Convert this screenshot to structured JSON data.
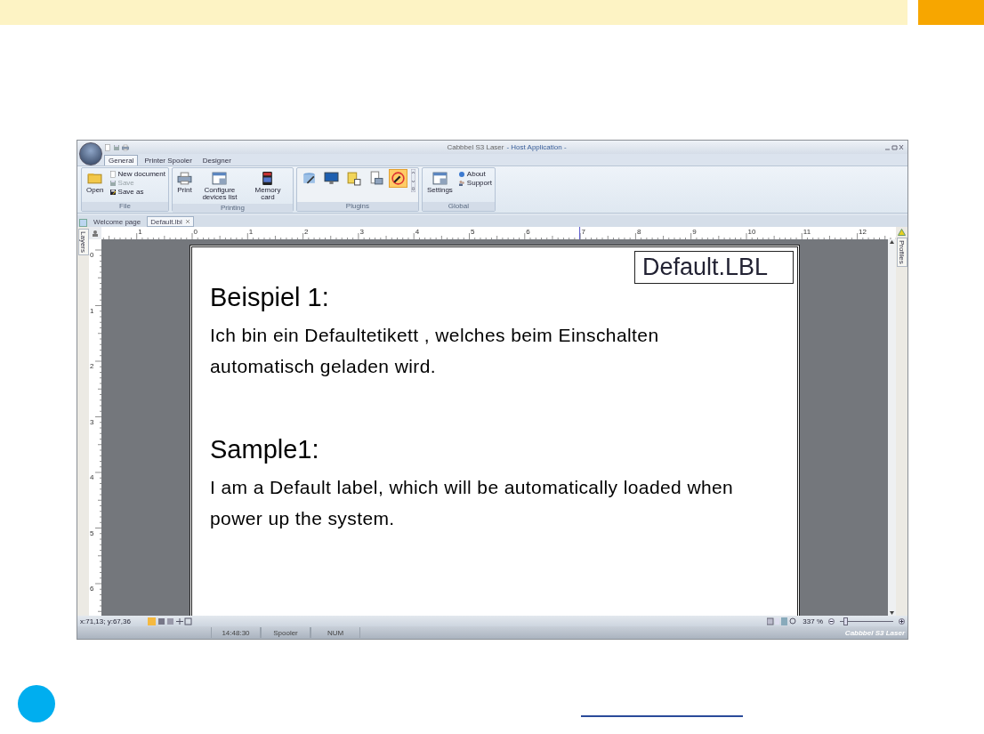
{
  "window": {
    "title_product": "Cabbbel S3 Laser",
    "title_app": "- Host Application -"
  },
  "ribbon_tabs": [
    {
      "label": "General",
      "selected": true
    },
    {
      "label": "Printer Spooler",
      "selected": false
    },
    {
      "label": "Designer",
      "selected": false
    }
  ],
  "ribbon_groups": [
    {
      "title": "File",
      "kind": "file",
      "large": [
        {
          "label": "Open"
        }
      ],
      "small": [
        {
          "label": "New document",
          "disabled": false
        },
        {
          "label": "Save",
          "disabled": true
        },
        {
          "label": "Save as",
          "disabled": false
        }
      ]
    },
    {
      "title": "Printing",
      "kind": "buttons",
      "large": [
        {
          "label": "Print"
        },
        {
          "label": "Configure devices list"
        },
        {
          "label": "Memory card"
        }
      ]
    },
    {
      "title": "Plugins",
      "kind": "gallery",
      "large": [
        {
          "selected": false
        },
        {
          "selected": false
        },
        {
          "selected": false
        },
        {
          "selected": false
        },
        {
          "selected": true
        }
      ]
    },
    {
      "title": "Global",
      "kind": "file",
      "large": [
        {
          "label": "Settings"
        }
      ],
      "small": [
        {
          "label": "About",
          "disabled": false
        },
        {
          "label": "Support",
          "disabled": false
        }
      ]
    }
  ],
  "doc_tabs": [
    {
      "label": "Welcome page",
      "selected": false
    },
    {
      "label": "Default.lbl",
      "selected": true
    }
  ],
  "left_panel": "Layers",
  "right_panel": "Profiles",
  "h_ruler": [
    "1",
    "0",
    "1",
    "2",
    "3",
    "4",
    "5",
    "6",
    "7",
    "8",
    "9",
    "10",
    "11",
    "12"
  ],
  "v_ruler": [
    "0",
    "1",
    "2",
    "3",
    "4",
    "5",
    "6"
  ],
  "label": {
    "name": "Default.LBL",
    "blocks": [
      {
        "kind": "heading",
        "text": "Beispiel 1:"
      },
      {
        "kind": "body",
        "text": "Ich bin ein Defaultetikett , welches beim Einschalten automatisch geladen wird."
      },
      {
        "kind": "heading",
        "text": "Sample1:"
      },
      {
        "kind": "body",
        "text": "I am a Default label, which will be automatically loaded when power up the system."
      }
    ]
  },
  "status_bar": {
    "coords": "x:71,13; y:67,36",
    "zoom": "337 %",
    "zoom_slider": {
      "level": 0.1
    },
    "cells": [
      "14:48:30",
      "Spooler",
      "NUM"
    ],
    "brand": "Cabbbel S3 Laser"
  }
}
